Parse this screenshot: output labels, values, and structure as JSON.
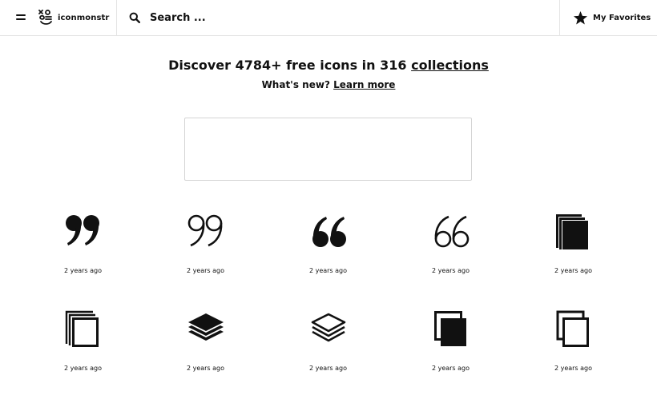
{
  "header": {
    "logo_text": "iconmonstr",
    "search_placeholder": "Search ...",
    "favorites_label": "My Favorites"
  },
  "hero": {
    "headline_prefix": "Discover 4784+ free icons in 316",
    "headline_link": "collections",
    "subline_prefix": "What's new?",
    "subline_link": "Learn more"
  },
  "icons": [
    {
      "name": "quote-filled-right-icon",
      "ago": "2 years ago"
    },
    {
      "name": "quote-outline-right-icon",
      "ago": "2 years ago"
    },
    {
      "name": "quote-filled-left-icon",
      "ago": "2 years ago"
    },
    {
      "name": "quote-outline-left-icon",
      "ago": "2 years ago"
    },
    {
      "name": "copy-filled-icon",
      "ago": "2 years ago"
    },
    {
      "name": "copy-outline-icon",
      "ago": "2 years ago"
    },
    {
      "name": "layers-filled-icon",
      "ago": "2 years ago"
    },
    {
      "name": "layers-outline-icon",
      "ago": "2 years ago"
    },
    {
      "name": "duplicate-filled-icon",
      "ago": "2 years ago"
    },
    {
      "name": "duplicate-outline-icon",
      "ago": "2 years ago"
    }
  ]
}
